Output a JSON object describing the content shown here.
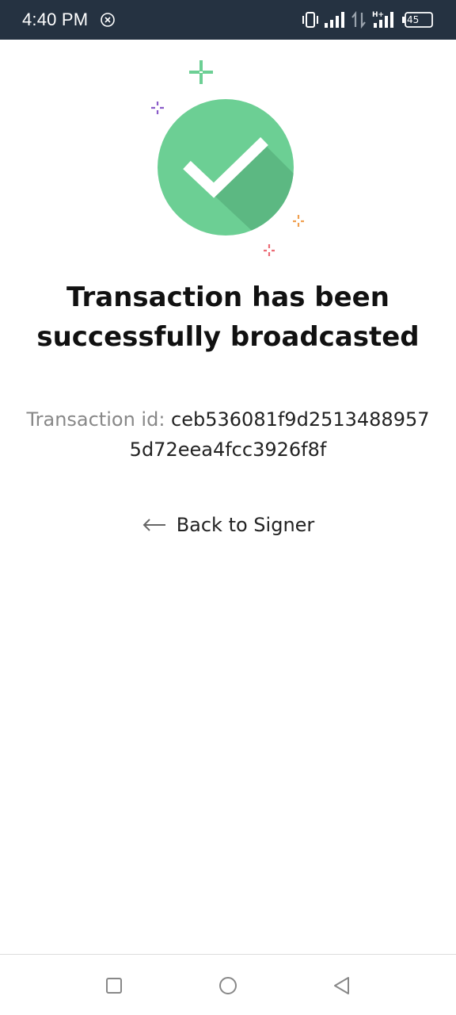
{
  "status_bar": {
    "time": "4:40 PM",
    "battery": "45",
    "icons": [
      "notification-x-icon",
      "vibrate-icon",
      "signal-icon",
      "data-arrows-icon",
      "hplus-icon",
      "signal-icon-2",
      "battery-icon"
    ]
  },
  "main": {
    "title_line1": "Transaction has been",
    "title_line2": "successfully broadcasted",
    "txid_label": "Transaction id:",
    "txid_value": "ceb536081f9d25134889575d72eea4fcc3926f8f",
    "back_label": "Back to Signer"
  },
  "colors": {
    "success_green": "#6ccf94",
    "shadow_green": "#5cb882",
    "status_bar_bg": "#253241",
    "sparkle_green": "#6ccf94",
    "sparkle_purple": "#8a5cc9",
    "sparkle_orange": "#f0a050",
    "sparkle_red": "#ec6a74"
  },
  "nav_bar": {
    "buttons": [
      "recent-apps-icon",
      "home-icon",
      "back-icon"
    ]
  }
}
